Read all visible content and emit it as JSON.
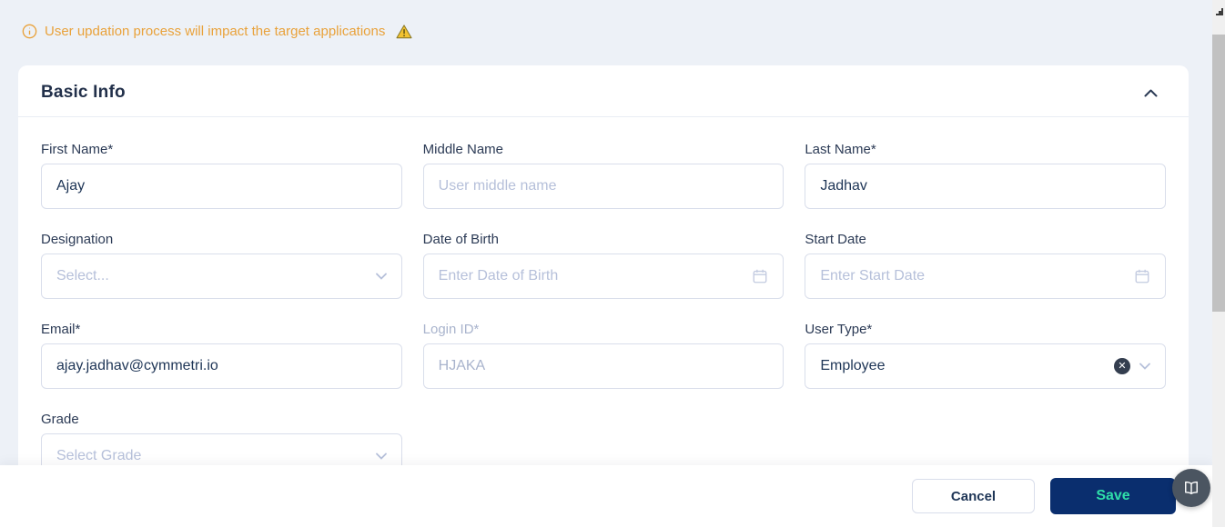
{
  "banner": {
    "message": "User updation process will impact the target applications"
  },
  "section": {
    "title": "Basic Info"
  },
  "form": {
    "first_name": {
      "label": "First Name*",
      "value": "Ajay"
    },
    "middle_name": {
      "label": "Middle Name",
      "placeholder": "User middle name"
    },
    "last_name": {
      "label": "Last Name*",
      "value": "Jadhav"
    },
    "designation": {
      "label": "Designation",
      "placeholder": "Select..."
    },
    "date_of_birth": {
      "label": "Date of Birth",
      "placeholder": "Enter Date of Birth"
    },
    "start_date": {
      "label": "Start Date",
      "placeholder": "Enter Start Date"
    },
    "email": {
      "label": "Email*",
      "value": "ajay.jadhav@cymmetri.io"
    },
    "login_id": {
      "label": "Login ID*",
      "value": "HJAKA"
    },
    "user_type": {
      "label": "User Type*",
      "value": "Employee",
      "clear_glyph": "✕"
    },
    "grade": {
      "label": "Grade",
      "placeholder": "Select Grade"
    }
  },
  "actions": {
    "cancel": "Cancel",
    "save": "Save"
  },
  "colors": {
    "warning_orange": "#E9A23B",
    "warning_triangle_fill": "#F2C230",
    "save_button_bg": "#0A2E6E",
    "save_button_text": "#2FDFA9",
    "page_bg": "#EDF1F7",
    "label_navy": "#2B3A55",
    "placeholder": "#B6C0DA"
  }
}
